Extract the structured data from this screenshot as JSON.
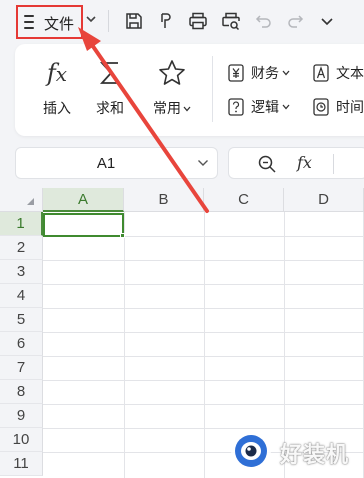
{
  "toolbar": {
    "file_label": "文件",
    "icons": [
      "menu-icon",
      "save-icon",
      "format-painter-icon",
      "print-icon",
      "print-preview-icon",
      "undo-icon",
      "redo-icon",
      "chevron-down-icon"
    ]
  },
  "ribbon": {
    "insert_label": "插入",
    "sum_label": "求和",
    "common_label": "常用",
    "finance_label": "财务",
    "text_label": "文本",
    "logic_label": "逻辑",
    "time_label": "时间"
  },
  "formula_bar": {
    "cell_reference": "A1",
    "fx_symbol": "fx"
  },
  "sheet": {
    "columns": [
      "A",
      "B",
      "C",
      "D"
    ],
    "rows": [
      "1",
      "2",
      "3",
      "4",
      "5",
      "6",
      "7",
      "8",
      "9",
      "10",
      "11"
    ],
    "active_cell": "A1"
  },
  "colors": {
    "highlight_red": "#e53935",
    "selection_green": "#3f8a2f"
  },
  "watermark": {
    "text": "好装机"
  }
}
